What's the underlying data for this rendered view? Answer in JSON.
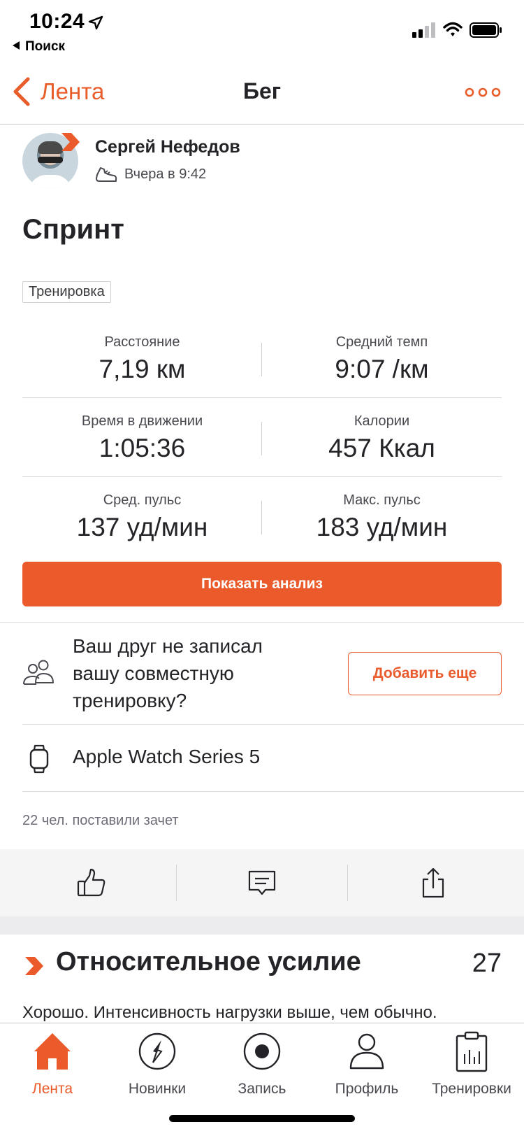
{
  "status_bar": {
    "time": "10:24",
    "back_label": "Поиск"
  },
  "nav": {
    "back_label": "Лента",
    "title": "Бег"
  },
  "athlete": {
    "name": "Сергей Нефедов",
    "time": "Вчера в 9:42"
  },
  "activity": {
    "title": "Спринт",
    "tag": "Тренировка",
    "stats": [
      {
        "label": "Расстояние",
        "value": "7,19 км"
      },
      {
        "label": "Средний темп",
        "value": "9:07 /км"
      },
      {
        "label": "Время в движении",
        "value": "1:05:36"
      },
      {
        "label": "Калории",
        "value": "457 Ккал"
      },
      {
        "label": "Сред. пульс",
        "value": "137 уд/мин"
      },
      {
        "label": "Макс. пульс",
        "value": "183 уд/мин"
      }
    ],
    "cta_label": "Показать анализ"
  },
  "friend_prompt": {
    "text": "Ваш друг не записал вашу совместную тренировку?",
    "button_label": "Добавить еще"
  },
  "device": {
    "name": "Apple Watch Series 5"
  },
  "kudos": {
    "text": "22 чел. поставили зачет"
  },
  "relative_effort": {
    "title": "Относительное усилие",
    "score": "27",
    "description": "Хорошо. Интенсивность нагрузки выше, чем обычно."
  },
  "tabbar": {
    "items": [
      {
        "label": "Лента",
        "icon": "home-icon",
        "active": true
      },
      {
        "label": "Новинки",
        "icon": "compass-icon",
        "active": false
      },
      {
        "label": "Запись",
        "icon": "record-icon",
        "active": false
      },
      {
        "label": "Профиль",
        "icon": "profile-icon",
        "active": false
      },
      {
        "label": "Тренировки",
        "icon": "training-log-icon",
        "active": false
      }
    ]
  },
  "colors": {
    "accent": "#ea5a2a",
    "text": "#242428",
    "muted": "#6d6d78"
  }
}
